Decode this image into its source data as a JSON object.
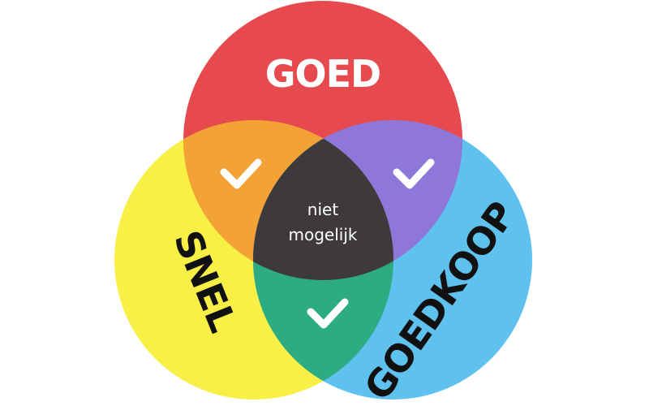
{
  "diagram": {
    "circles": {
      "goed": {
        "label": "GOED",
        "color": "#e64a4f",
        "text_color": "#ffffff"
      },
      "snel": {
        "label": "SNEL",
        "color": "#f8ef47",
        "text_color": "#111111"
      },
      "goedkoop": {
        "label": "GOEDKOOP",
        "color": "#5ec1ee",
        "text_color": "#111111"
      }
    },
    "overlaps": {
      "goed_snel": {
        "color": "#f3a235",
        "mark": "check-icon"
      },
      "goed_goedkoop": {
        "color": "#8e77d8",
        "mark": "check-icon"
      },
      "snel_goedkoop": {
        "color": "#2dac82",
        "mark": "check-icon"
      }
    },
    "center": {
      "color": "#3e3a3b",
      "line1": "niet",
      "line2": "mogelijk"
    }
  }
}
